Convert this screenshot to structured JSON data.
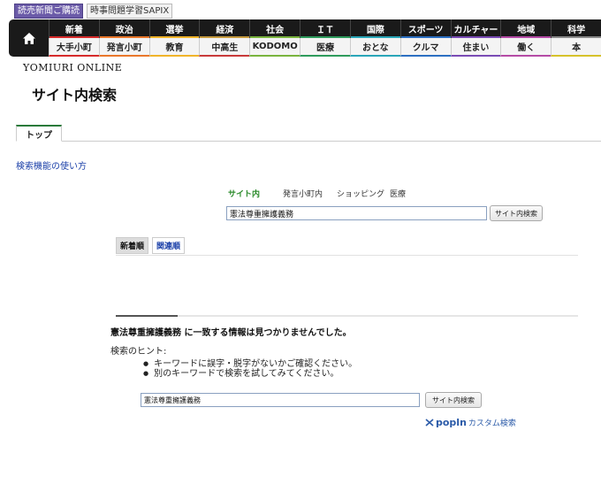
{
  "top_banners": [
    "読売新聞ご購読",
    "時事問題学習SAPIX"
  ],
  "nav": {
    "home_icon": "home-icon",
    "top_row": [
      {
        "label": "新着",
        "color": "#d62b2b"
      },
      {
        "label": "政治",
        "color": "#e9772b"
      },
      {
        "label": "選挙",
        "color": "#f0b42a"
      },
      {
        "label": "経済",
        "color": "#c69b3f"
      },
      {
        "label": "社会",
        "color": "#7ab43e"
      },
      {
        "label": "ＩＴ",
        "color": "#2e9b5c"
      },
      {
        "label": "国際",
        "color": "#2aa6b8"
      },
      {
        "label": "スポーツ",
        "color": "#2c6fc2"
      },
      {
        "label": "カルチャー",
        "color": "#7a4bb5"
      },
      {
        "label": "地域",
        "color": "#b54ba6"
      },
      {
        "label": "科学",
        "color": "#8a8a8a"
      }
    ],
    "bottom_row": [
      {
        "label": "大手小町",
        "color": "#d62b2b"
      },
      {
        "label": "発言小町",
        "color": "#e9772b"
      },
      {
        "label": "教育",
        "color": "#f0b42a"
      },
      {
        "label": "中高生",
        "color": "#c83a3a"
      },
      {
        "label": "KODOMO",
        "color": "#7ab43e"
      },
      {
        "label": "医療",
        "color": "#2e9b5c"
      },
      {
        "label": "おとな",
        "color": "#2aa6b8"
      },
      {
        "label": "クルマ",
        "color": "#2c6fc2"
      },
      {
        "label": "住まい",
        "color": "#7a4bb5"
      },
      {
        "label": "働く",
        "color": "#b54ba6"
      },
      {
        "label": "本",
        "color": "#d6c22b"
      }
    ]
  },
  "logo": "YOMIURI ONLINE",
  "page_title": "サイト内検索",
  "tabs": [
    "トップ"
  ],
  "help_link": "検索機能の使い方",
  "scopes": [
    "サイト内",
    "発言小町内",
    "ショッピング",
    "医療"
  ],
  "search": {
    "value": "憲法尊重擁護義務",
    "button": "サイト内検索"
  },
  "sort": [
    "新着順",
    "関連順"
  ],
  "no_results": "憲法尊重擁護義務 に一致する情報は見つかりませんでした。",
  "hint_title": "検索のヒント:",
  "hints": [
    "キーワードに誤字・脱字がないかご確認ください。",
    "別のキーワードで検索を試してみてください。"
  ],
  "search2": {
    "value": "憲法尊重擁護義務",
    "button": "サイト内検索"
  },
  "popln": {
    "brand": "popln",
    "label": "カスタム検索"
  }
}
